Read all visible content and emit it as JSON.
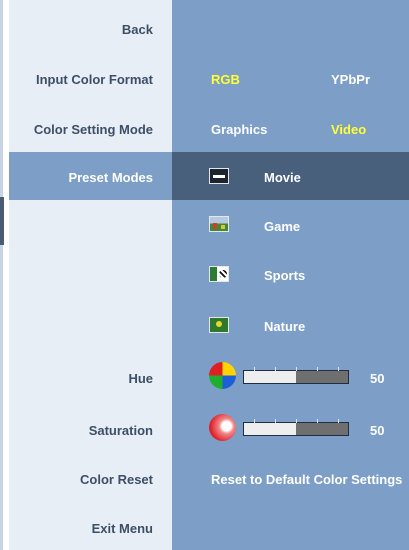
{
  "menu": {
    "back": "Back",
    "input_color_format": {
      "label": "Input Color Format",
      "options": [
        "RGB",
        "YPbPr"
      ],
      "selected": "RGB"
    },
    "color_setting_mode": {
      "label": "Color Setting Mode",
      "options": [
        "Graphics",
        "Video"
      ],
      "selected": "Video"
    },
    "preset_modes": {
      "label": "Preset Modes",
      "items": [
        {
          "label": "Movie",
          "icon": "movie-icon"
        },
        {
          "label": "Game",
          "icon": "game-icon"
        },
        {
          "label": "Sports",
          "icon": "sports-icon"
        },
        {
          "label": "Nature",
          "icon": "nature-icon"
        }
      ]
    },
    "hue": {
      "label": "Hue",
      "value": "50",
      "level": 0.5,
      "icon": "hue-color-wheel-icon"
    },
    "saturation": {
      "label": "Saturation",
      "value": "50",
      "level": 0.5,
      "icon": "saturation-ball-icon"
    },
    "color_reset": {
      "label": "Color Reset",
      "action": "Reset to Default Color Settings"
    },
    "exit": "Exit Menu"
  },
  "colors": {
    "left_panel": "#e8eef5",
    "right_panel": "#7d9ec6",
    "highlight": "#49607d",
    "active_option": "#ffff33",
    "label_text": "#3c4f66"
  }
}
